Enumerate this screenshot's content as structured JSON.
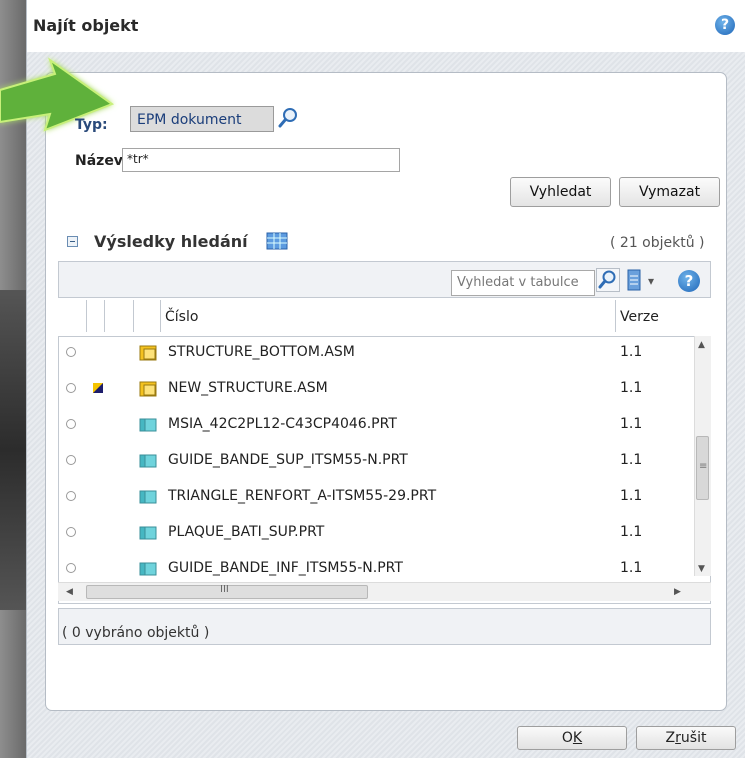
{
  "dialog": {
    "title": "Najít objekt",
    "help_icon": "help-icon"
  },
  "criteria": {
    "type_label": "Typ:",
    "type_value": "EPM dokument",
    "name_label": "Název:",
    "name_value": "*tr*",
    "search_button": "Vyhledat",
    "clear_button": "Vymazat"
  },
  "results": {
    "title": "Výsledky hledání",
    "count": "( 21 objektů )",
    "table_search_placeholder": "Vyhledat v tabulce",
    "columns": [
      "Číslo",
      "Verze"
    ],
    "rows": [
      {
        "number": "STRUCTURE_BOTTOM.ASM",
        "version": "1.1",
        "type_icon": "assembly-icon",
        "status_icon": ""
      },
      {
        "number": "NEW_STRUCTURE.ASM",
        "version": "1.1",
        "type_icon": "assembly-icon",
        "status_icon": "checked-out-icon"
      },
      {
        "number": "MSIA_42C2PL12-C43CP4046.PRT",
        "version": "1.1",
        "type_icon": "part-icon",
        "status_icon": ""
      },
      {
        "number": "GUIDE_BANDE_SUP_ITSM55-N.PRT",
        "version": "1.1",
        "type_icon": "part-icon",
        "status_icon": ""
      },
      {
        "number": "TRIANGLE_RENFORT_A-ITSM55-29.PRT",
        "version": "1.1",
        "type_icon": "part-icon",
        "status_icon": ""
      },
      {
        "number": "PLAQUE_BATI_SUP.PRT",
        "version": "1.1",
        "type_icon": "part-icon",
        "status_icon": ""
      },
      {
        "number": "GUIDE_BANDE_INF_ITSM55-N.PRT",
        "version": "1.1",
        "type_icon": "part-icon",
        "status_icon": ""
      }
    ],
    "selected_status": "( 0 vybráno objektů )",
    "hscroll_grip": "III",
    "vscroll_grip": "≡"
  },
  "footer": {
    "ok_pre": "O",
    "ok_mnemonic": "K",
    "cancel_pre": "Z",
    "cancel_mnemonic": "r",
    "cancel_post": "ušit"
  },
  "colors": {
    "arrow": "#5fb13a",
    "help": "#1f66b8",
    "accent_label": "#2a4a7a"
  }
}
